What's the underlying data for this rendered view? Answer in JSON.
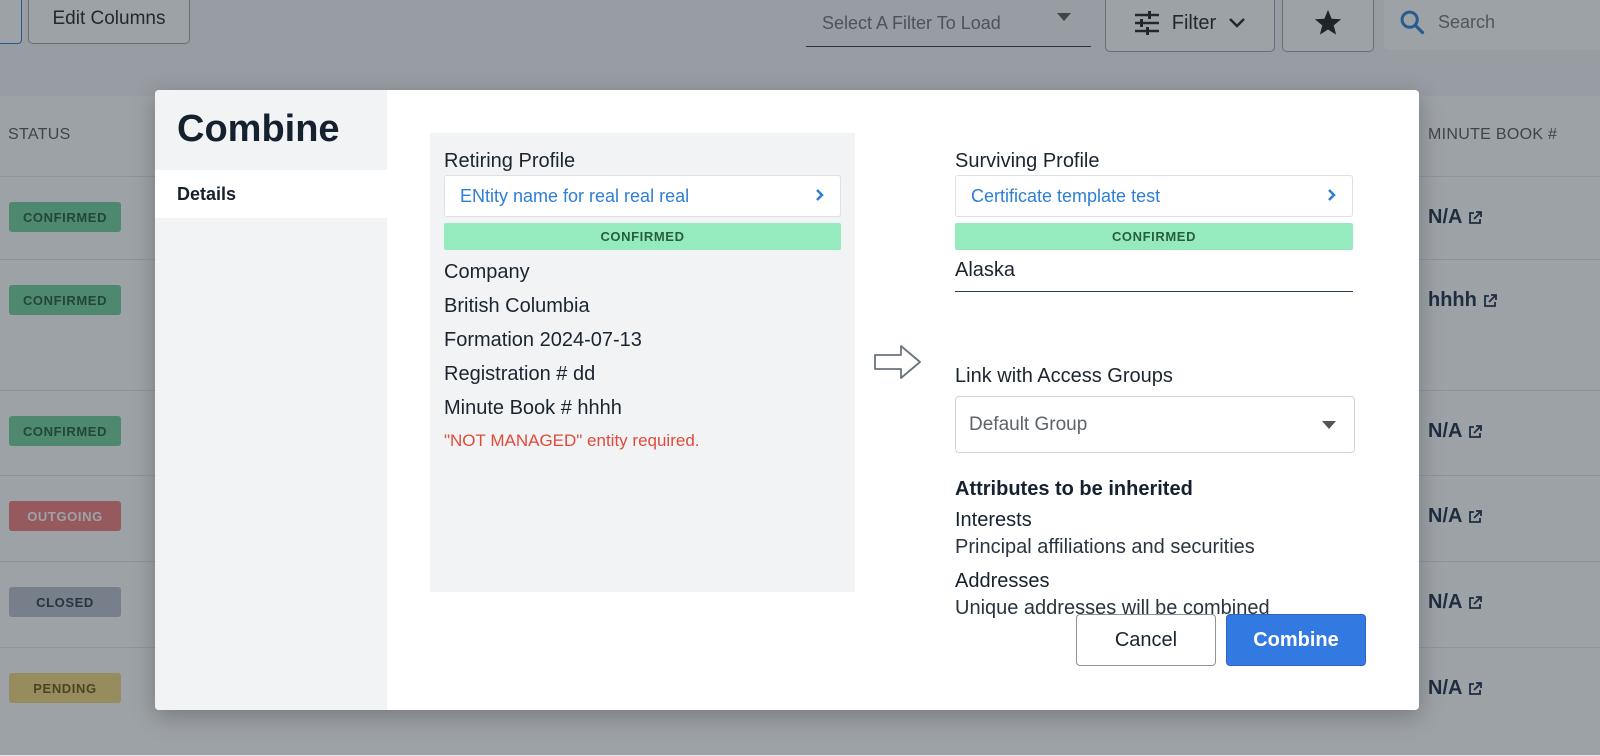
{
  "toolbar": {
    "edit_columns_label": "Edit Columns",
    "filter_select_placeholder": "Select A Filter To Load",
    "filter_button_label": "Filter",
    "search_placeholder": "Search"
  },
  "table": {
    "columns": {
      "status": "STATUS",
      "minute_book": "MINUTE BOOK #"
    },
    "rows": [
      {
        "status": "CONFIRMED",
        "status_color": "#6fcf97",
        "minute_book": "N/A"
      },
      {
        "status": "CONFIRMED",
        "status_color": "#6fcf97",
        "minute_book": "hhhh"
      },
      {
        "status": "CONFIRMED",
        "status_color": "#6fcf97",
        "minute_book": "N/A"
      },
      {
        "status": "OUTGOING",
        "status_color": "#f07a7a",
        "minute_book": "N/A"
      },
      {
        "status": "CLOSED",
        "status_color": "#b9c0ca",
        "minute_book": "N/A"
      },
      {
        "status": "PENDING",
        "status_color": "#f5d77a",
        "minute_book": "N/A"
      }
    ]
  },
  "modal": {
    "title": "Combine",
    "tabs": [
      {
        "label": "Details"
      }
    ],
    "retiring": {
      "label": "Retiring Profile",
      "entity_name": "ENtity name for real real real",
      "status": "CONFIRMED",
      "entity_type": "Company",
      "jurisdiction": "British Columbia",
      "formation": "Formation 2024-07-13",
      "registration": "Registration # dd",
      "minute_book": "Minute Book # hhhh",
      "warning": "\"NOT MANAGED\" entity required."
    },
    "surviving": {
      "label": "Surviving Profile",
      "entity_name": "Certificate template test",
      "status": "CONFIRMED",
      "jurisdiction": "Alaska"
    },
    "access_groups": {
      "label": "Link with Access Groups",
      "selected": "Default Group"
    },
    "attributes": {
      "title": "Attributes to be inherited",
      "items": [
        {
          "name": "Interests",
          "description": "Principal affiliations and securities"
        },
        {
          "name": "Addresses",
          "description": "Unique addresses will be combined"
        }
      ]
    },
    "buttons": {
      "cancel": "Cancel",
      "combine": "Combine"
    }
  },
  "colors": {
    "accent_blue": "#3279e2",
    "link_blue": "#2d7fd3",
    "confirmed_bar": "#95ebbd",
    "warning_red": "#e04b3c"
  }
}
